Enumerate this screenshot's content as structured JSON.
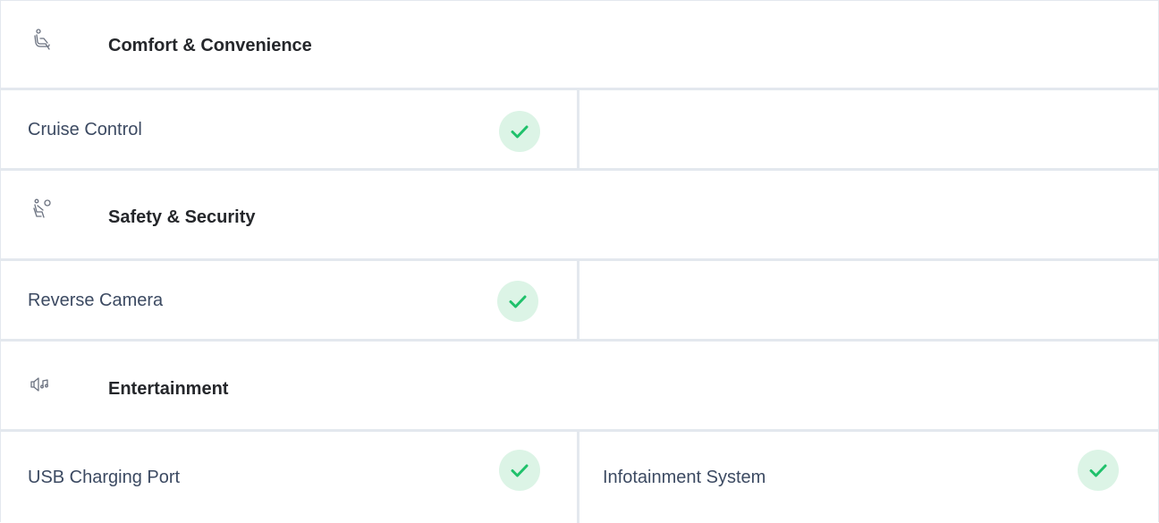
{
  "categories": [
    {
      "title": "Comfort & Convenience",
      "icon": "seat-icon",
      "features": [
        {
          "label": "Cruise Control",
          "available": true
        },
        {
          "label": "",
          "available": false
        }
      ]
    },
    {
      "title": "Safety & Security",
      "icon": "seatbelt-passenger-icon",
      "features": [
        {
          "label": "Reverse Camera",
          "available": true
        },
        {
          "label": "",
          "available": false
        }
      ]
    },
    {
      "title": "Entertainment",
      "icon": "speaker-music-icon",
      "features": [
        {
          "label": "USB Charging Port",
          "available": true
        },
        {
          "label": "Infotainment System",
          "available": true
        }
      ]
    }
  ],
  "colors": {
    "check_green": "#1fc16b",
    "check_bg": "#dcf4e6",
    "border": "#e3e8ee",
    "title_text": "#25272b",
    "feature_text": "#3c4a62",
    "icon_stroke": "#6b7280"
  }
}
